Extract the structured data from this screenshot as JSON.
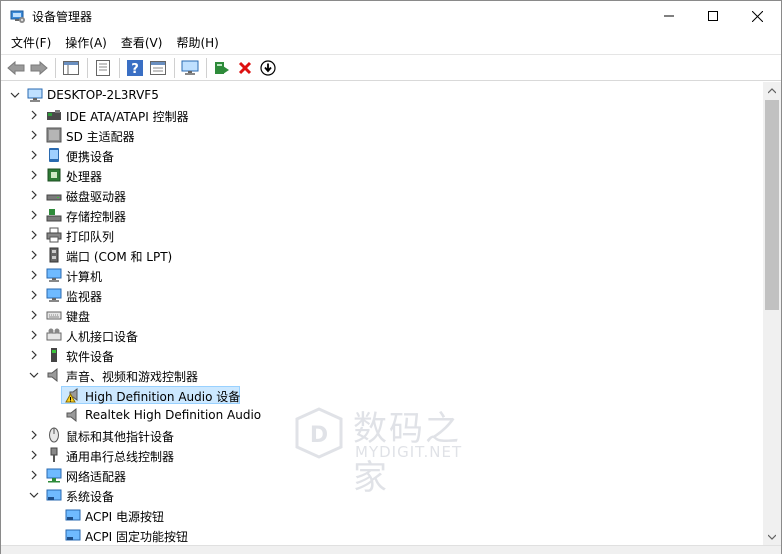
{
  "window": {
    "title": "设备管理器"
  },
  "menu": [
    "文件(F)",
    "操作(A)",
    "查看(V)",
    "帮助(H)"
  ],
  "toolbar": {
    "buttons": [
      "back-icon",
      "forward-icon",
      "sep",
      "properties-icon",
      "sep",
      "show-hide-tree-icon",
      "sep",
      "help-icon",
      "view-icon",
      "sep",
      "monitor-icon",
      "sep",
      "update-driver-icon",
      "uninstall-icon",
      "download-icon"
    ]
  },
  "tree": {
    "root": "DESKTOP-2L3RVF5",
    "categories": [
      {
        "label": "IDE ATA/ATAPI 控制器",
        "icon": "ide-icon",
        "expanded": false
      },
      {
        "label": "SD 主适配器",
        "icon": "sd-icon",
        "expanded": false
      },
      {
        "label": "便携设备",
        "icon": "portable-icon",
        "expanded": false
      },
      {
        "label": "处理器",
        "icon": "cpu-icon",
        "expanded": false
      },
      {
        "label": "磁盘驱动器",
        "icon": "disk-icon",
        "expanded": false
      },
      {
        "label": "存储控制器",
        "icon": "storage-icon",
        "expanded": false
      },
      {
        "label": "打印队列",
        "icon": "printer-icon",
        "expanded": false
      },
      {
        "label": "端口 (COM 和 LPT)",
        "icon": "port-icon",
        "expanded": false
      },
      {
        "label": "计算机",
        "icon": "computer-icon",
        "expanded": false
      },
      {
        "label": "监视器",
        "icon": "monitor-icon",
        "expanded": false
      },
      {
        "label": "键盘",
        "icon": "keyboard-icon",
        "expanded": false
      },
      {
        "label": "人机接口设备",
        "icon": "hid-icon",
        "expanded": false
      },
      {
        "label": "软件设备",
        "icon": "software-icon",
        "expanded": false
      },
      {
        "label": "声音、视频和游戏控制器",
        "icon": "speaker-icon",
        "expanded": true,
        "children": [
          {
            "label": "High Definition Audio 设备",
            "icon": "warning-speaker-icon",
            "selected": true
          },
          {
            "label": "Realtek High Definition Audio",
            "icon": "speaker-icon"
          }
        ]
      },
      {
        "label": "鼠标和其他指针设备",
        "icon": "mouse-icon",
        "expanded": false
      },
      {
        "label": "通用串行总线控制器",
        "icon": "usb-icon",
        "expanded": false
      },
      {
        "label": "网络适配器",
        "icon": "network-icon",
        "expanded": false
      },
      {
        "label": "系统设备",
        "icon": "system-icon",
        "expanded": true,
        "children": [
          {
            "label": "ACPI 电源按钮",
            "icon": "system-icon"
          },
          {
            "label": "ACPI 固定功能按钮",
            "icon": "system-icon"
          }
        ]
      }
    ]
  },
  "watermark": {
    "cn": "数码之家",
    "en": "MYDIGIT.NET"
  }
}
